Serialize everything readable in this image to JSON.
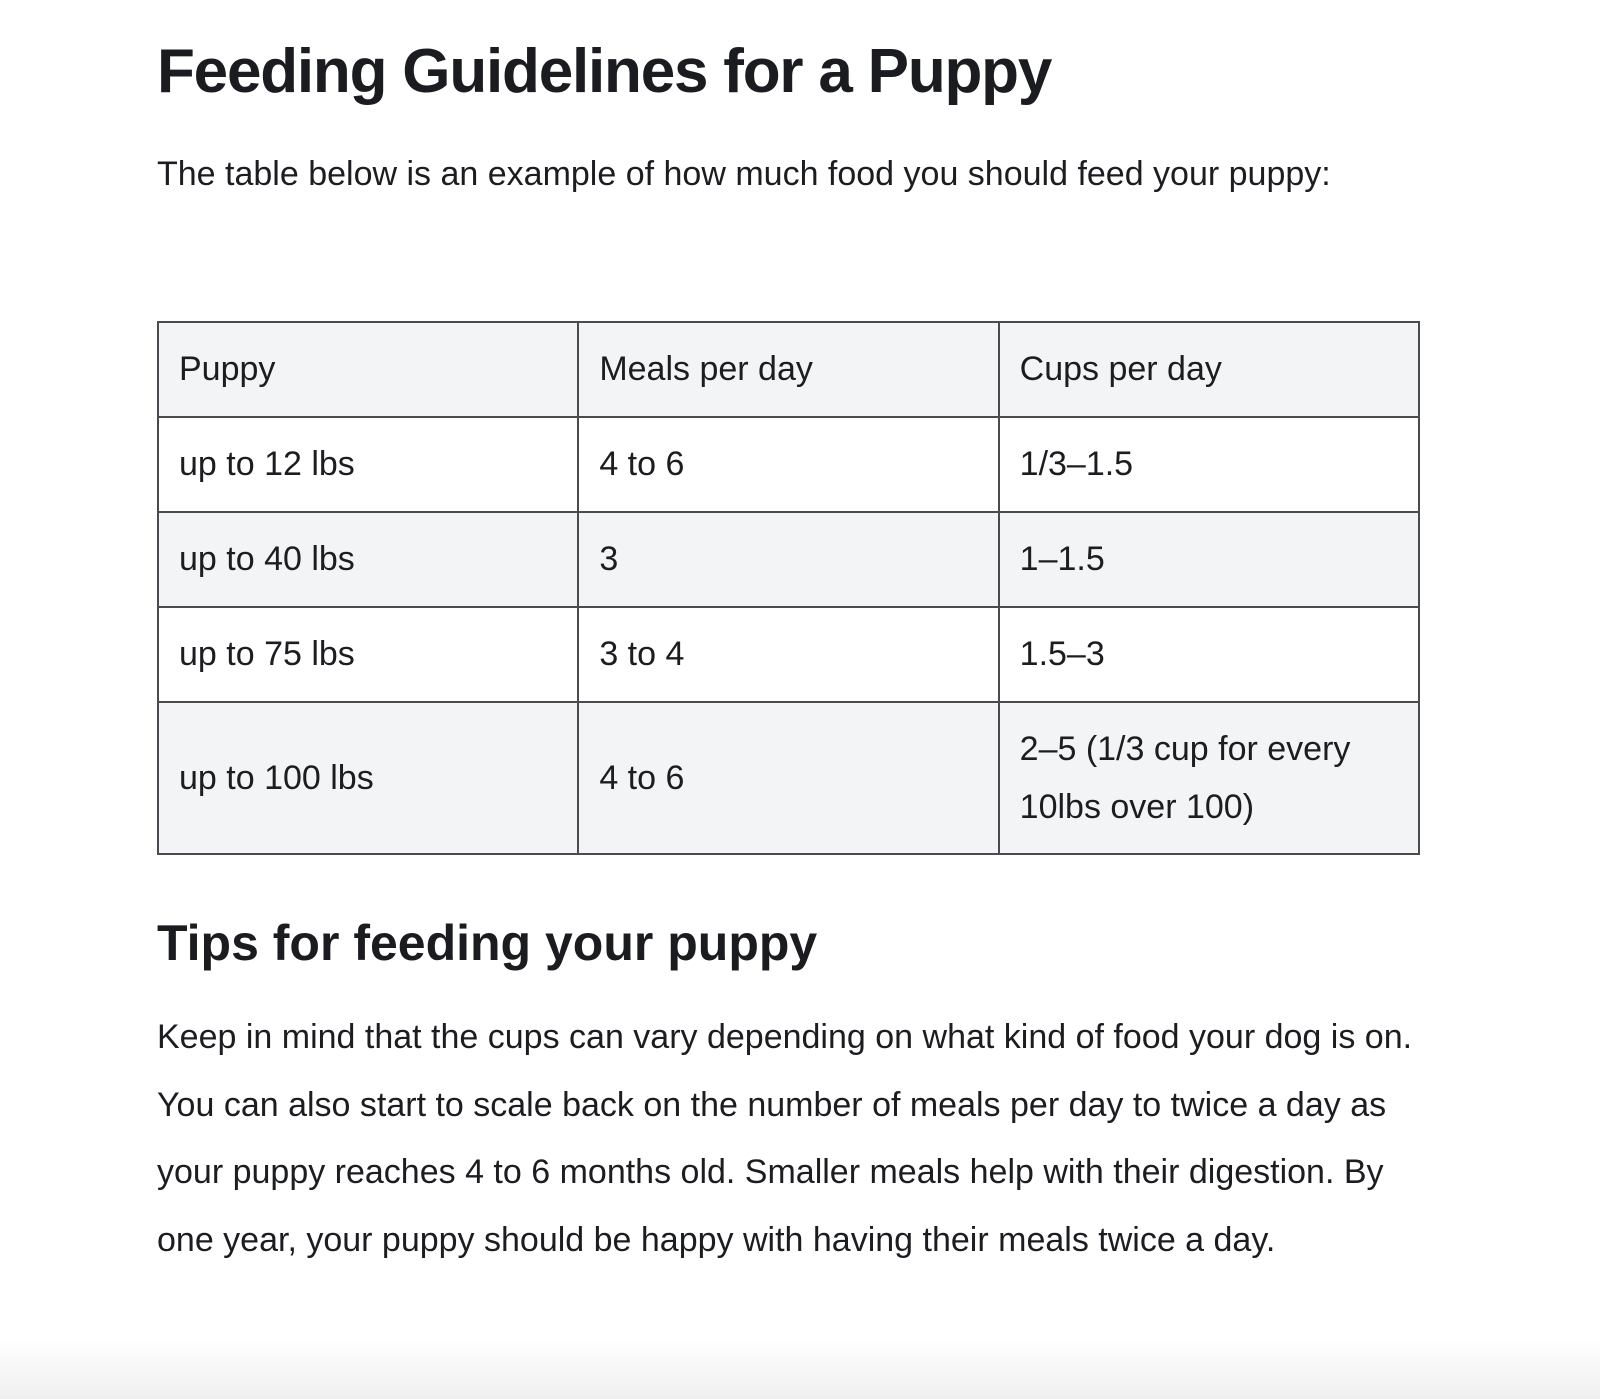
{
  "page": {
    "title": "Feeding Guidelines for a Puppy",
    "intro": "The table below is an example of how much food you should feed your puppy:"
  },
  "table": {
    "headers": [
      "Puppy",
      "Meals per day",
      "Cups per day"
    ],
    "rows": [
      [
        "up to 12 lbs",
        "4 to 6",
        "1/3–1.5"
      ],
      [
        "up to 40 lbs",
        "3",
        "1–1.5"
      ],
      [
        "up to 75 lbs",
        "3 to 4",
        "1.5–3"
      ],
      [
        "up to 100 lbs",
        "4 to 6",
        "2–5 (1/3 cup for every 10lbs over 100)"
      ]
    ]
  },
  "tips": {
    "heading": "Tips for feeding your puppy",
    "body": "Keep in mind that the cups can vary depending on what kind of food your dog is on. You can also start to scale back on the number of meals per day to twice a day as your puppy reaches 4 to 6 months old. Smaller meals help with their digestion. By one year, your puppy should be happy with having their meals twice a day."
  }
}
